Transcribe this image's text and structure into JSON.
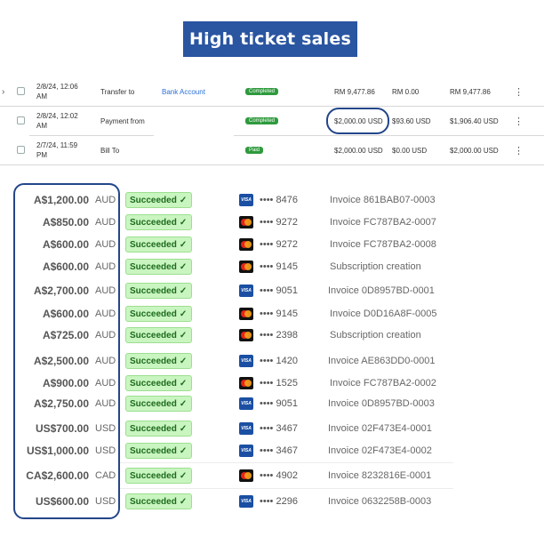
{
  "banner": {
    "title": "High ticket sales"
  },
  "transactions": [
    {
      "date": "2/8/24, 12:06 AM",
      "type": "Transfer to",
      "link": "Bank Account",
      "status": "Completed",
      "col1": "RM 9,477.86",
      "col2": "RM 0.00",
      "col3": "RM 9,477.86"
    },
    {
      "date": "2/8/24, 12:02 AM",
      "type": "Payment from",
      "link": "",
      "status": "Completed",
      "col1": "$2,000.00 USD",
      "col2": "$93.60 USD",
      "col3": "$1,906.40 USD"
    },
    {
      "date": "2/7/24, 11:59 PM",
      "type": "Bill To",
      "link": "",
      "status": "Paid",
      "col1": "$2,000.00 USD",
      "col2": "$0.00 USD",
      "col3": "$2,000.00 USD"
    }
  ],
  "payments": [
    {
      "amount": "A$1,200.00",
      "currency": "AUD",
      "status": "Succeeded",
      "brand": "visa",
      "last4": "•••• 8476",
      "description": "Invoice 861BAB07-0003"
    },
    {
      "amount": "A$850.00",
      "currency": "AUD",
      "status": "Succeeded",
      "brand": "mastercard",
      "last4": "•••• 9272",
      "description": "Invoice FC787BA2-0007"
    },
    {
      "amount": "A$600.00",
      "currency": "AUD",
      "status": "Succeeded",
      "brand": "mastercard",
      "last4": "•••• 9272",
      "description": "Invoice FC787BA2-0008"
    },
    {
      "amount": "A$600.00",
      "currency": "AUD",
      "status": "Succeeded",
      "brand": "mastercard",
      "last4": "•••• 9145",
      "description": "Subscription creation"
    },
    {
      "amount": "A$2,700.00",
      "currency": "AUD",
      "status": "Succeeded",
      "brand": "visa",
      "last4": "•••• 9051",
      "description": "Invoice 0D8957BD-0001"
    },
    {
      "amount": "A$600.00",
      "currency": "AUD",
      "status": "Succeeded",
      "brand": "mastercard",
      "last4": "•••• 9145",
      "description": "Invoice D0D16A8F-0005"
    },
    {
      "amount": "A$725.00",
      "currency": "AUD",
      "status": "Succeeded",
      "brand": "mastercard",
      "last4": "•••• 2398",
      "description": "Subscription creation"
    },
    {
      "amount": "A$2,500.00",
      "currency": "AUD",
      "status": "Succeeded",
      "brand": "visa",
      "last4": "•••• 1420",
      "description": "Invoice AE863DD0-0001"
    },
    {
      "amount": "A$900.00",
      "currency": "AUD",
      "status": "Succeeded",
      "brand": "mastercard",
      "last4": "•••• 1525",
      "description": "Invoice FC787BA2-0002"
    },
    {
      "amount": "A$2,750.00",
      "currency": "AUD",
      "status": "Succeeded",
      "brand": "visa",
      "last4": "•••• 9051",
      "description": "Invoice 0D8957BD-0003"
    },
    {
      "amount": "US$700.00",
      "currency": "USD",
      "status": "Succeeded",
      "brand": "visa",
      "last4": "•••• 3467",
      "description": "Invoice 02F473E4-0001"
    },
    {
      "amount": "US$1,000.00",
      "currency": "USD",
      "status": "Succeeded",
      "brand": "visa",
      "last4": "•••• 3467",
      "description": "Invoice 02F473E4-0002"
    },
    {
      "amount": "CA$2,600.00",
      "currency": "CAD",
      "status": "Succeeded",
      "brand": "mastercard",
      "last4": "•••• 4902",
      "description": "Invoice 8232816E-0001"
    },
    {
      "amount": "US$600.00",
      "currency": "USD",
      "status": "Succeeded",
      "brand": "visa",
      "last4": "•••• 2296",
      "description": "Invoice 0632258B-0003"
    }
  ],
  "icons": {
    "card_visa_text": "VISA",
    "check": "✓",
    "kebab": "⋮",
    "chevron": "›"
  },
  "colors": {
    "banner": "#2a55a0",
    "highlight_frame": "#23468a",
    "succeeded_bg": "#c9f5c0",
    "completed_badge": "#2e9a3d"
  }
}
